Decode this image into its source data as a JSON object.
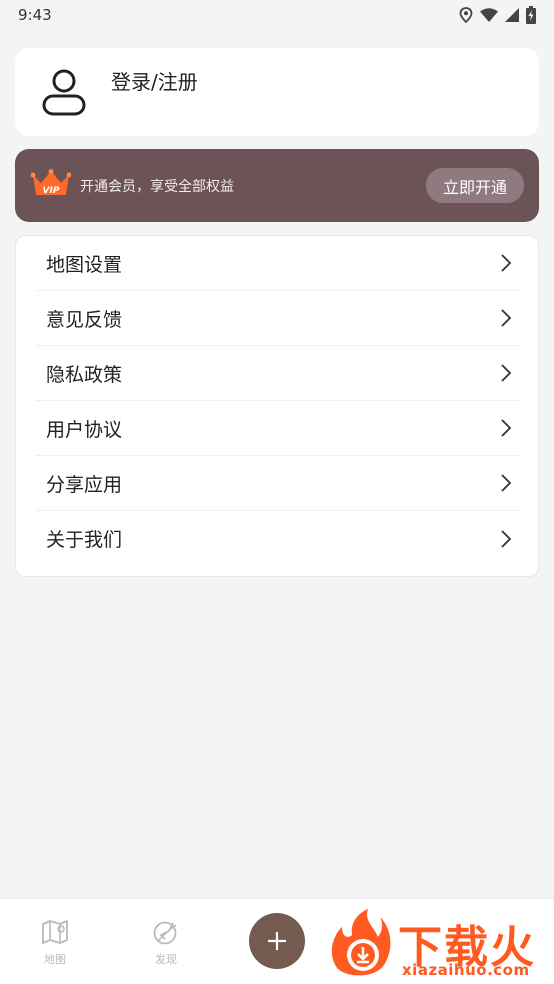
{
  "status_bar": {
    "time": "9:43",
    "icons": [
      "location-icon",
      "wifi-icon",
      "signal-icon",
      "battery-charging-icon"
    ]
  },
  "login": {
    "label": "登录/注册",
    "icon": "user-avatar-icon"
  },
  "vip": {
    "badge": "VIP",
    "text": "开通会员，享受全部权益",
    "button_label": "立即开通",
    "banner_color": "#6b5358",
    "crown_color": "#ff6a2a"
  },
  "menu": {
    "items": [
      {
        "label": "地图设置"
      },
      {
        "label": "意见反馈"
      },
      {
        "label": "隐私政策"
      },
      {
        "label": "用户协议"
      },
      {
        "label": "分享应用"
      },
      {
        "label": "关于我们"
      }
    ]
  },
  "bottom_nav": {
    "items": [
      {
        "label": "地图",
        "icon": "map-icon"
      },
      {
        "label": "发现",
        "icon": "compass-icon"
      }
    ],
    "fab_icon": "plus-icon",
    "fab_color": "#745a4f"
  },
  "watermark": {
    "title": "下载火",
    "url": "xiazaihuo.com"
  }
}
